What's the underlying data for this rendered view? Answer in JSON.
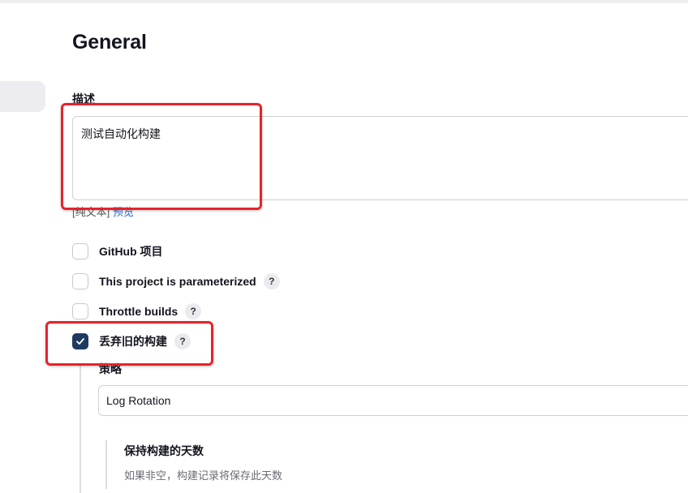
{
  "section": {
    "title": "General"
  },
  "description": {
    "label": "描述",
    "value": "测试自动化构建",
    "format_prefix": "[纯文本]",
    "preview_link": "预览"
  },
  "options": [
    {
      "label": "GitHub 项目",
      "checked": false,
      "has_help": false
    },
    {
      "label": "This project is parameterized",
      "checked": false,
      "has_help": true
    },
    {
      "label": "Throttle builds",
      "checked": false,
      "has_help": true
    },
    {
      "label": "丢弃旧的构建",
      "checked": true,
      "has_help": true
    }
  ],
  "help_glyph": "?",
  "strategy": {
    "label": "策略",
    "selected": "Log Rotation"
  },
  "days_to_keep": {
    "label": "保持构建的天数",
    "hint": "如果非空，构建记录将保存此天数"
  },
  "colors": {
    "checkbox_checked": "#1e3a5f",
    "annotation_red": "#e8222a",
    "link_blue": "#1b62d1"
  },
  "icons": {
    "checkbox_check": "check-icon",
    "help": "help-icon"
  }
}
